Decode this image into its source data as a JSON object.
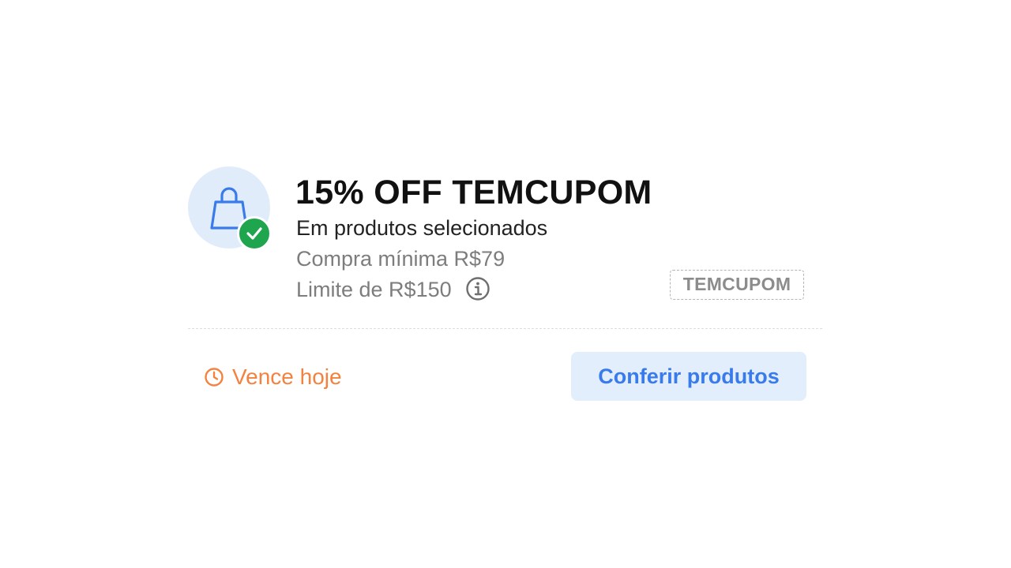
{
  "coupon": {
    "icon": "shopping-bag-icon",
    "badge_icon": "check-icon",
    "title": "15% OFF TEMCUPOM",
    "subtitle": "Em produtos selecionados",
    "min_purchase": "Compra mínima R$79",
    "limit": "Limite de R$150",
    "info_icon": "info-icon",
    "code": "TEMCUPOM",
    "expiry_icon": "clock-icon",
    "expiry": "Vence hoje",
    "cta_label": "Conferir produtos"
  },
  "colors": {
    "accent_blue": "#3a7bec",
    "icon_bg": "#e1ecfb",
    "success_green": "#1ea54e",
    "expiry_orange": "#f4823f",
    "button_bg": "#e3eefc"
  }
}
